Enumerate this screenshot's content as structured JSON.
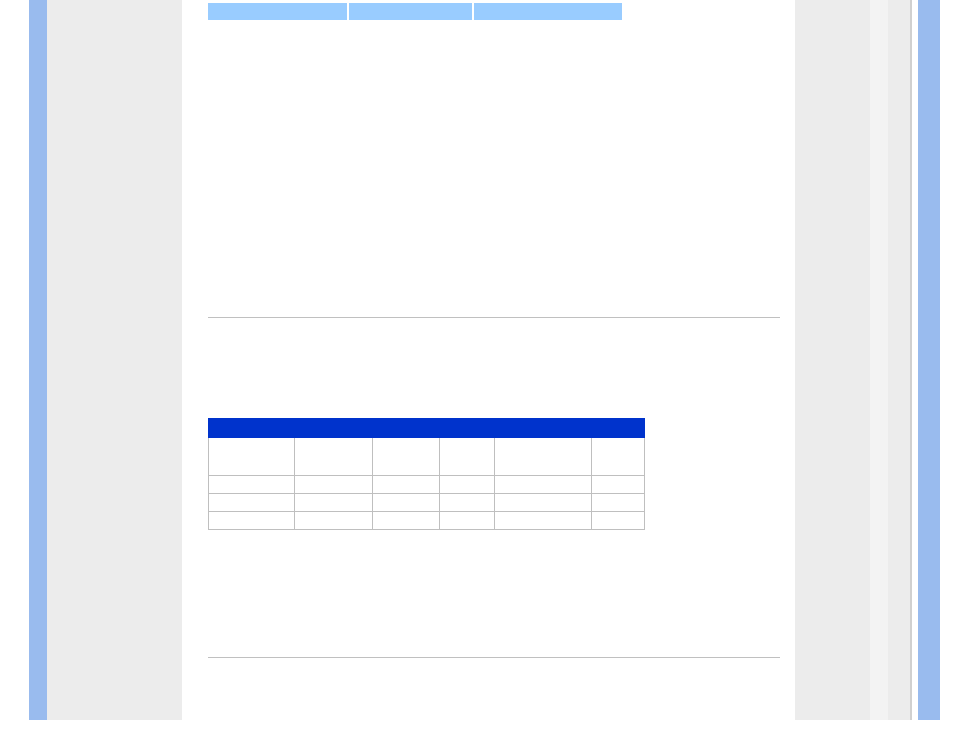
{
  "tabs": {
    "a": "",
    "b": "",
    "c": ""
  },
  "table": {
    "title": "",
    "headers": [
      "",
      "",
      "",
      "",
      "",
      ""
    ],
    "rows": [
      [
        "",
        "",
        "",
        "",
        "",
        ""
      ],
      [
        "",
        "",
        "",
        "",
        "",
        ""
      ],
      [
        "",
        "",
        "",
        "",
        "",
        ""
      ]
    ]
  }
}
